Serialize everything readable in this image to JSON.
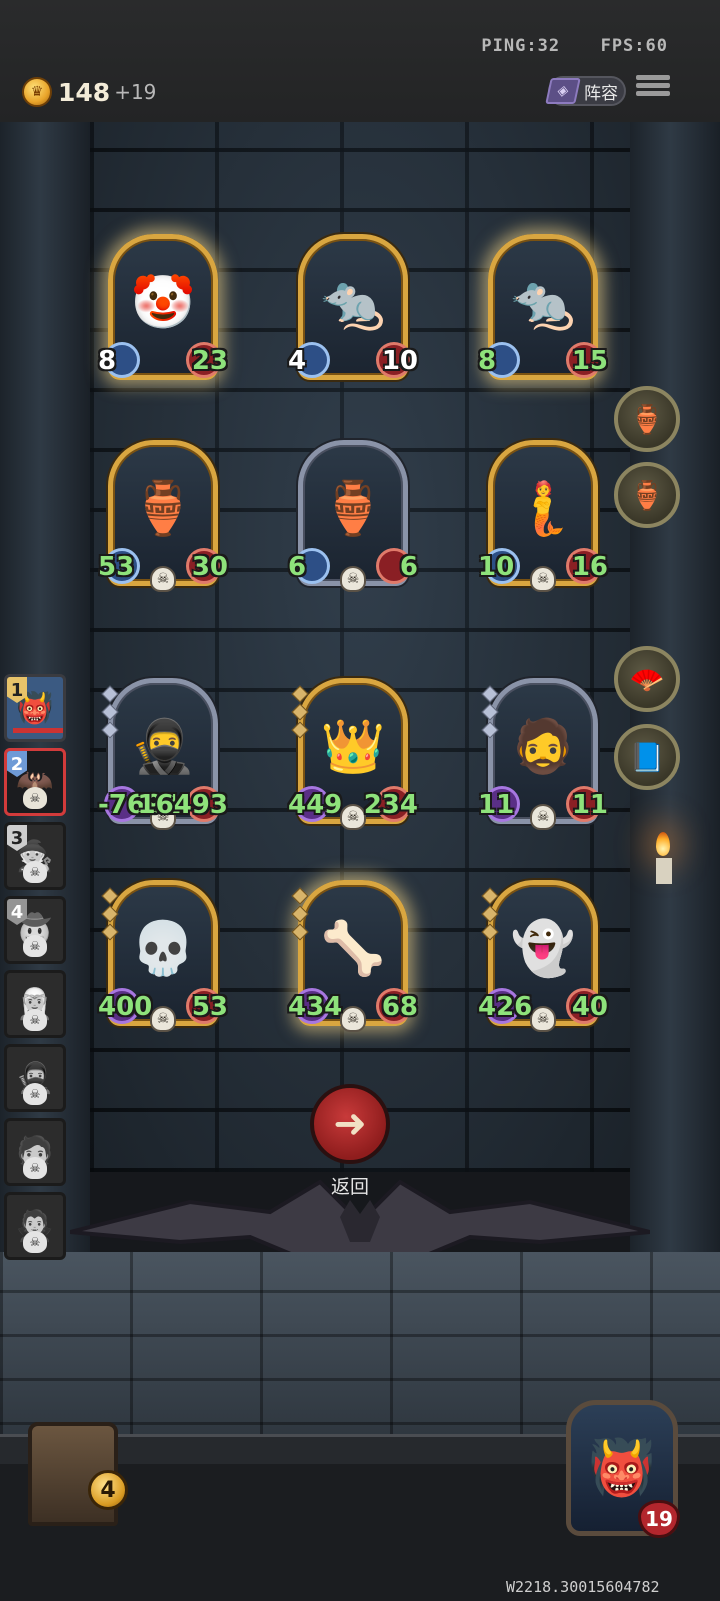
{
  "status": {
    "ping": "PING:32",
    "fps": "FPS:60"
  },
  "economy": {
    "coins": "148",
    "income": "+19"
  },
  "lineup_button": {
    "label": "阵容"
  },
  "board": {
    "rows": [
      [
        {
          "name": "clown",
          "emoji": "🤡",
          "attack": "8",
          "health": "23",
          "atk_color": "white",
          "hp_color": "green",
          "frame": "gold",
          "glow": true
        },
        {
          "name": "rat-bandit",
          "emoji": "🐀",
          "attack": "4",
          "health": "10",
          "atk_color": "white",
          "hp_color": "white",
          "frame": "gold",
          "glow": false
        },
        {
          "name": "rat-bandit-golden",
          "emoji": "🐀",
          "attack": "8",
          "health": "15",
          "atk_color": "green",
          "hp_color": "green",
          "frame": "gold",
          "glow": true
        }
      ],
      [
        {
          "name": "cursed-urn",
          "emoji": "🏺",
          "attack": "53",
          "health": "30",
          "atk_color": "green",
          "hp_color": "green",
          "frame": "gold",
          "glow": false
        },
        {
          "name": "cursed-urn-silver",
          "emoji": "🏺",
          "attack": "6",
          "health": "6",
          "atk_color": "green",
          "hp_color": "green",
          "frame": "silver",
          "glow": false
        },
        {
          "name": "feathered-priestess",
          "emoji": "🧜",
          "attack": "10",
          "health": "16",
          "atk_color": "green",
          "hp_color": "green",
          "frame": "gold",
          "glow": false
        }
      ],
      [
        {
          "name": "red-hood-assassin",
          "emoji": "🥷",
          "attack": "-7691",
          "health": "16493",
          "atk_color": "green",
          "hp_color": "green",
          "frame": "silver",
          "glow": false
        },
        {
          "name": "dark-king",
          "emoji": "👑",
          "attack": "449",
          "health": "234",
          "atk_color": "green",
          "hp_color": "green",
          "frame": "gold",
          "glow": false
        },
        {
          "name": "mad-scholar",
          "emoji": "🧔",
          "attack": "11",
          "health": "11",
          "atk_color": "green",
          "hp_color": "green",
          "frame": "silver",
          "glow": false
        }
      ],
      [
        {
          "name": "grim-reaper",
          "emoji": "💀",
          "attack": "400",
          "health": "53",
          "atk_color": "green",
          "hp_color": "green",
          "frame": "gold",
          "glow": false
        },
        {
          "name": "bone-lich",
          "emoji": "🦴",
          "attack": "434",
          "health": "68",
          "atk_color": "green",
          "hp_color": "green",
          "frame": "gold",
          "glow": true
        },
        {
          "name": "spectral-vampire",
          "emoji": "👻",
          "attack": "426",
          "health": "40",
          "atk_color": "green",
          "hp_color": "green",
          "frame": "gold",
          "glow": false
        }
      ]
    ]
  },
  "item_slots": [
    {
      "icon": "urn-icon",
      "emoji": "🏺"
    },
    {
      "icon": "urn-icon",
      "emoji": "🏺"
    },
    {
      "icon": "fan-icon",
      "emoji": "🪭"
    },
    {
      "icon": "book-icon",
      "emoji": "📘"
    }
  ],
  "roster": [
    {
      "rank": "1",
      "emoji": "👹",
      "state": "active"
    },
    {
      "rank": "2",
      "emoji": "🦇",
      "state": "current"
    },
    {
      "rank": "3",
      "emoji": "🧙",
      "state": "eliminated"
    },
    {
      "rank": "4",
      "emoji": "🤠",
      "state": "eliminated"
    },
    {
      "rank": "",
      "emoji": "🧝",
      "state": "eliminated"
    },
    {
      "rank": "",
      "emoji": "🥷",
      "state": "eliminated"
    },
    {
      "rank": "",
      "emoji": "🧑",
      "state": "eliminated"
    },
    {
      "rank": "",
      "emoji": "🧛",
      "state": "eliminated"
    }
  ],
  "back_button": {
    "label": "返回"
  },
  "chest": {
    "count": "4"
  },
  "hero": {
    "emoji": "👹",
    "health": "19"
  },
  "footer": {
    "build_id": "W2218.30015604782"
  }
}
